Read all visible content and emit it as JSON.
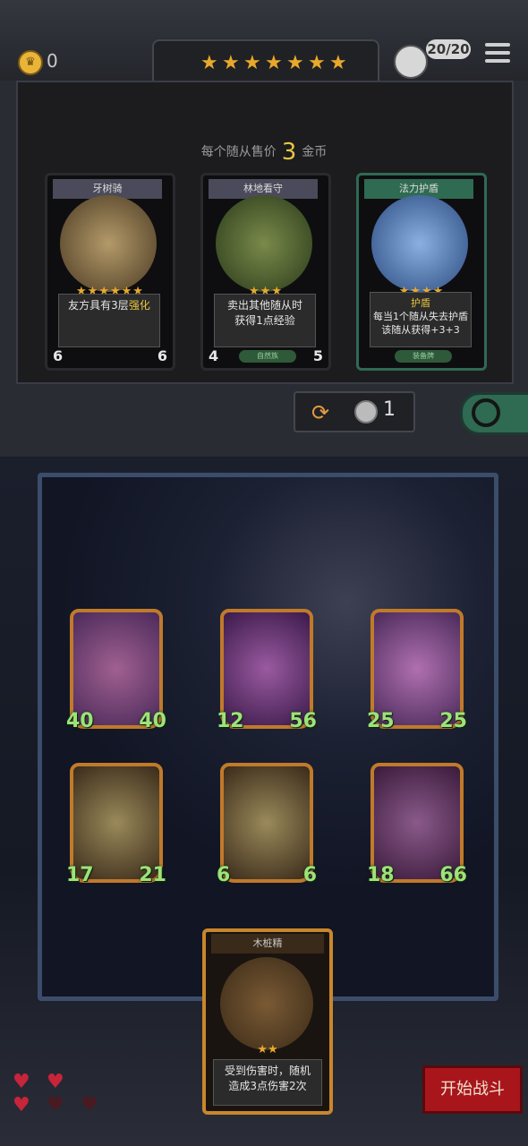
{
  "header": {
    "gold": "0",
    "tier_stars": 7,
    "turn": "20/20"
  },
  "shop": {
    "sell_prefix": "每个随从售价",
    "sell_price": "3",
    "sell_suffix": "金币",
    "cards": [
      {
        "name": "牙树骑",
        "stars": 6,
        "desc_plain": "友方具有3层",
        "desc_hl": "强化",
        "atk": "6",
        "hp": "6",
        "tag": "",
        "art_color": "#b49a6a"
      },
      {
        "name": "林地看守",
        "stars": 3,
        "desc_line1": "卖出其他随从时",
        "desc_line2": "获得1点经验",
        "atk": "4",
        "hp": "5",
        "tag": "自然族",
        "art_color": "#556a3a"
      },
      {
        "name": "法力护盾",
        "stars": 4,
        "desc_title": "护盾",
        "desc_line1": "每当1个随从失去护盾",
        "desc_line2": "该随从获得+3+3",
        "atk": "",
        "hp": "",
        "tag": "装备牌",
        "art_color": "#4a7cc0"
      }
    ],
    "refresh_cost": "1"
  },
  "board": {
    "units": [
      {
        "atk": "40",
        "hp": "40",
        "color": "#7a4a8a"
      },
      {
        "atk": "12",
        "hp": "56",
        "color": "#6a3c7a"
      },
      {
        "atk": "25",
        "hp": "25",
        "color": "#8a4a8a"
      },
      {
        "atk": "17",
        "hp": "21",
        "color": "#6a5a3a"
      },
      {
        "atk": "6",
        "hp": "6",
        "color": "#6a5a3a"
      },
      {
        "atk": "18",
        "hp": "66",
        "color": "#5a3a6a"
      }
    ]
  },
  "hand": {
    "name": "木桩精",
    "stars": 2,
    "desc_line1": "受到伤害时，随机",
    "desc_line2": "造成3点伤害2次"
  },
  "lives": {
    "full": 3,
    "empty": 2
  },
  "start_button": "开始战斗",
  "colors": {
    "accent": "#e8a92b",
    "start": "#a8161c",
    "stat": "#9ee27a"
  }
}
